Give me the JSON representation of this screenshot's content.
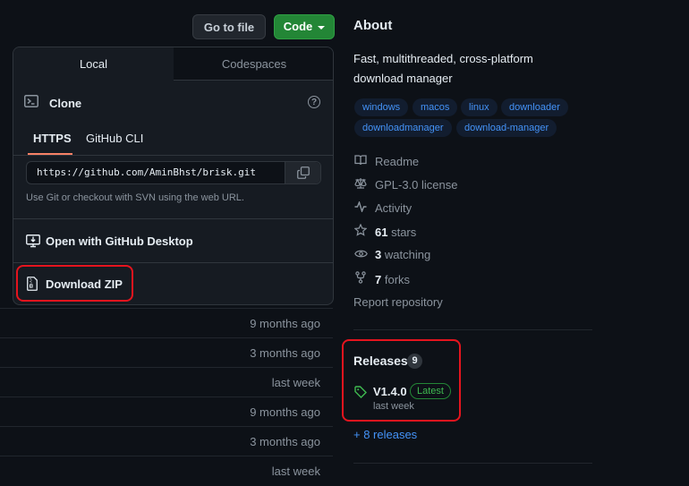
{
  "buttons": {
    "go_to_file": "Go to file",
    "code": "Code"
  },
  "clone_dropdown": {
    "tabs": [
      "Local",
      "Codespaces"
    ],
    "clone_title": "Clone",
    "help_symbol": "?",
    "subtabs": [
      "HTTPS",
      "GitHub CLI"
    ],
    "url": "https://github.com/AminBhst/brisk.git",
    "hint": "Use Git or checkout with SVN using the web URL.",
    "open_desktop": "Open with GitHub Desktop",
    "download_zip": "Download ZIP"
  },
  "file_rows": [
    {
      "time": "9 months ago"
    },
    {
      "time": "3 months ago"
    },
    {
      "time": "last week"
    },
    {
      "time": "9 months ago"
    },
    {
      "time": "3 months ago"
    },
    {
      "time": "last week"
    }
  ],
  "about": {
    "title": "About",
    "description": "Fast, multithreaded, cross-platform download manager",
    "topics": [
      "windows",
      "macos",
      "linux",
      "downloader",
      "downloadmanager",
      "download-manager"
    ],
    "readme": "Readme",
    "license": "GPL-3.0 license",
    "activity": "Activity",
    "stars_count": "61",
    "stars_label": "stars",
    "watching_count": "3",
    "watching_label": "watching",
    "forks_count": "7",
    "forks_label": "forks",
    "report": "Report repository"
  },
  "releases": {
    "title": "Releases",
    "count": "9",
    "latest_name": "V1.4.0",
    "latest_badge": "Latest",
    "latest_date": "last week",
    "more": "+ 8 releases"
  },
  "colors": {
    "background": "#0d1117",
    "code_button": "#238636",
    "link": "#4493f8",
    "highlight": "#e5141e"
  }
}
